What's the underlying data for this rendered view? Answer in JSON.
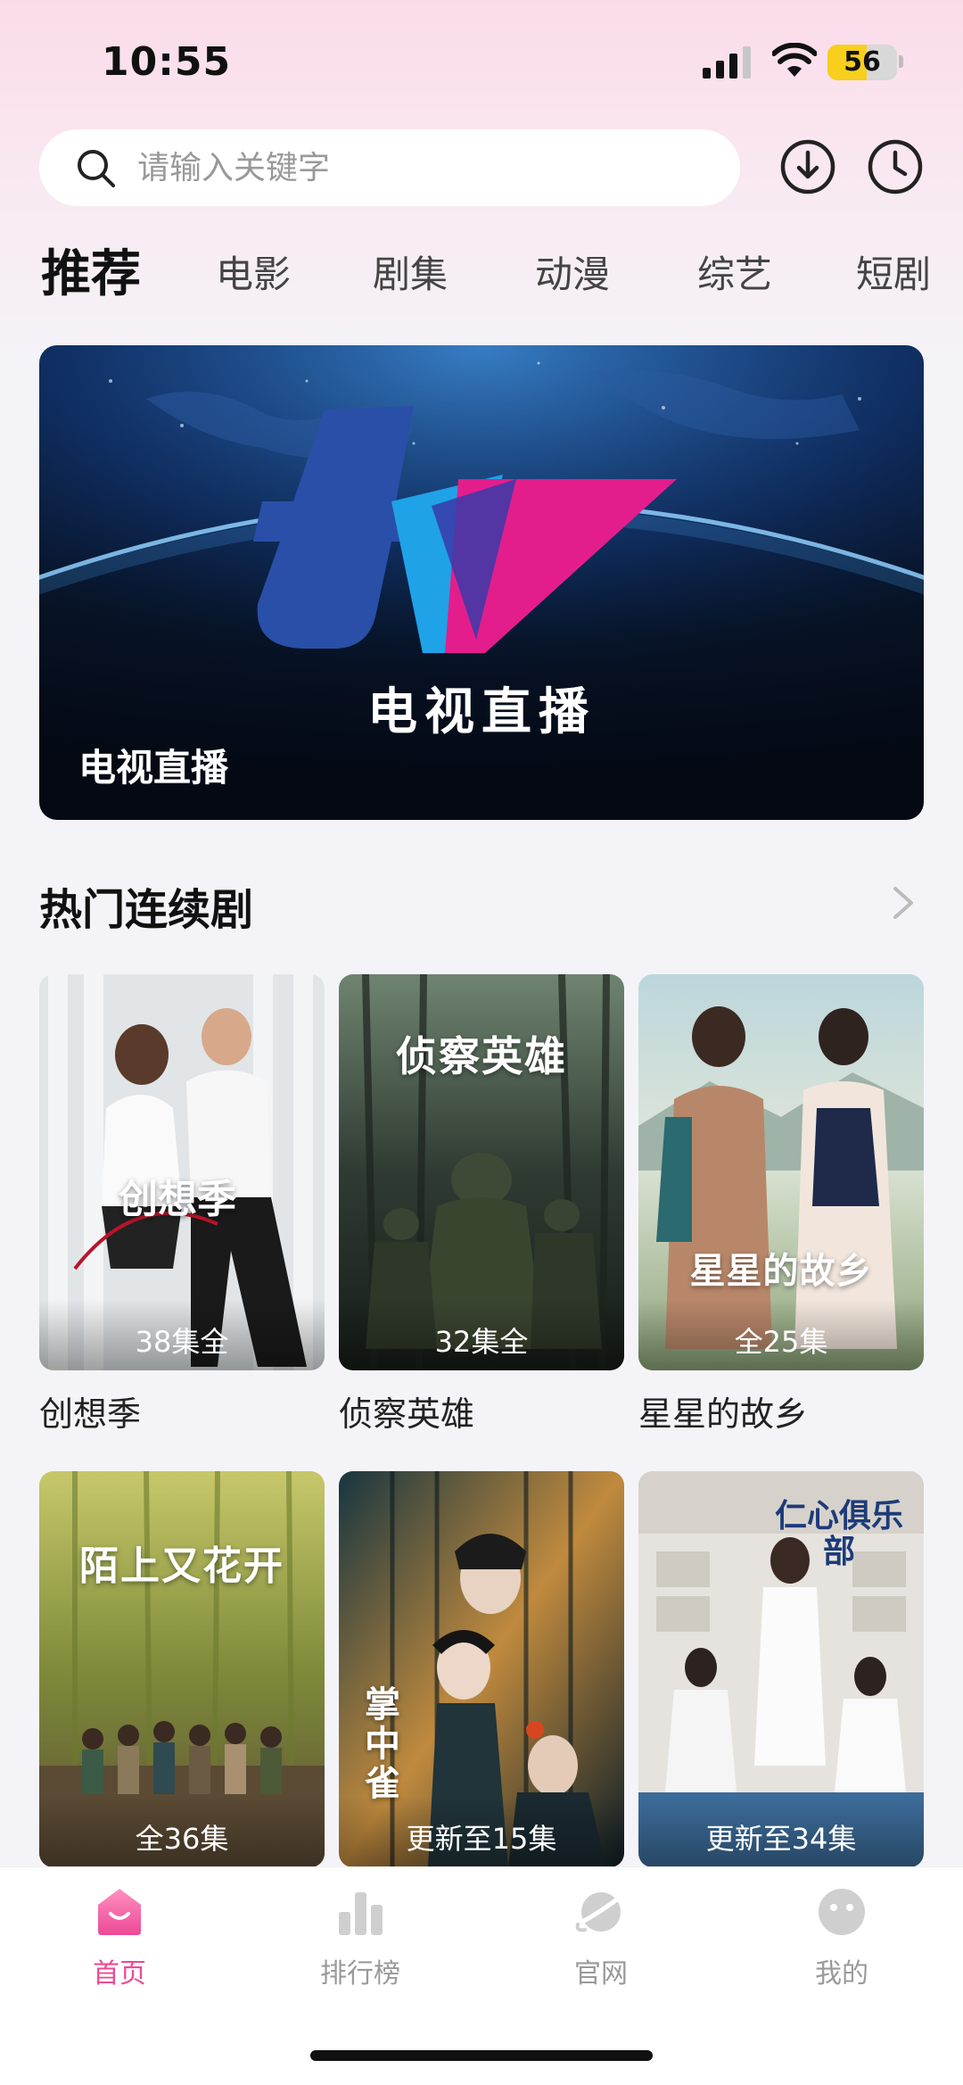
{
  "status_bar": {
    "time": "10:55",
    "battery": "56",
    "battery_level_percent": 56
  },
  "search": {
    "placeholder": "请输入关键字",
    "icons": [
      "search-icon",
      "download-icon",
      "history-clock-icon"
    ]
  },
  "tabs": [
    {
      "label": "推荐",
      "active": true
    },
    {
      "label": "电影",
      "active": false
    },
    {
      "label": "剧集",
      "active": false
    },
    {
      "label": "动漫",
      "active": false
    },
    {
      "label": "综艺",
      "active": false
    },
    {
      "label": "短剧",
      "active": false
    }
  ],
  "banner": {
    "logo_text": "tv",
    "logo_title": "电视直播",
    "label": "电视直播"
  },
  "section": {
    "title": "热门连续剧",
    "more_icon": "chevron-right-icon"
  },
  "dramas": [
    {
      "title": "创想季",
      "poster_title": "创想季",
      "episodes": "38集全"
    },
    {
      "title": "侦察英雄",
      "poster_title": "侦察英雄",
      "episodes": "32集全"
    },
    {
      "title": "星星的故乡",
      "poster_title": "星星的故乡",
      "episodes": "全25集"
    },
    {
      "title": "",
      "poster_title": "陌上又花开",
      "episodes": "全36集"
    },
    {
      "title": "",
      "poster_title": "掌中雀",
      "episodes": "更新至15集"
    },
    {
      "title": "",
      "poster_title": "仁心俱乐部",
      "episodes": "更新至34集"
    }
  ],
  "bottom_nav": [
    {
      "label": "首页",
      "icon": "home-bag-icon",
      "active": true
    },
    {
      "label": "排行榜",
      "icon": "bar-chart-icon",
      "active": false
    },
    {
      "label": "官网",
      "icon": "planet-icon",
      "active": false
    },
    {
      "label": "我的",
      "icon": "smiley-icon",
      "active": false
    }
  ],
  "colors": {
    "accent": "#ec4a95",
    "tab_text": "#444444",
    "banner_dark": "#071326"
  }
}
